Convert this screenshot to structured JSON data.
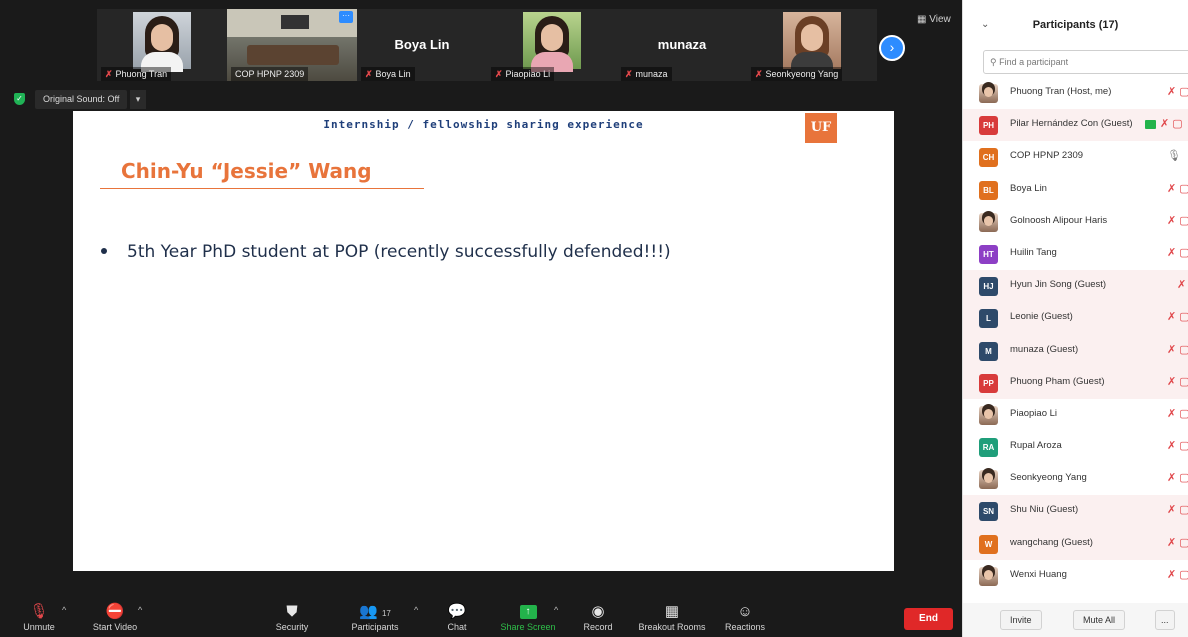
{
  "thumbnails": [
    {
      "name": "Phuong Tran",
      "type": "photo",
      "style": "light",
      "muted": true
    },
    {
      "name": "COP HPNP 2309",
      "type": "room",
      "muted": false,
      "active": true
    },
    {
      "name": "Boya Lin",
      "type": "name",
      "muted": true
    },
    {
      "name": "Piaopiao Li",
      "type": "photo",
      "style": "green",
      "muted": true
    },
    {
      "name": "munaza",
      "type": "name",
      "muted": true
    },
    {
      "name": "Seonkyeong Yang",
      "type": "photo",
      "style": "warm",
      "muted": true
    }
  ],
  "view_label": "View",
  "original_sound": "Original Sound: Off",
  "slide": {
    "header": "Internship / fellowship sharing experience",
    "logo": "UF",
    "title": "Chin-Yu “Jessie” Wang",
    "bullet": "5th Year PhD student at POP (recently successfully defended!!!)"
  },
  "toolbar": {
    "unmute": "Unmute",
    "start_video": "Start Video",
    "security": "Security",
    "participants": "Participants",
    "participants_count": "17",
    "chat": "Chat",
    "share_screen": "Share Screen",
    "record": "Record",
    "breakout_rooms": "Breakout Rooms",
    "reactions": "Reactions",
    "end": "End"
  },
  "panel": {
    "title": "Participants (17)",
    "search_placeholder": "Find a participant",
    "participants": [
      {
        "name": "Phuong Tran (Host, me)",
        "initials": "",
        "color": "",
        "photo": true,
        "shaded": false,
        "status": "muted"
      },
      {
        "name": "Pilar Hernández Con (Guest)",
        "initials": "PH",
        "color": "#d83b3b",
        "photo": false,
        "shaded": true,
        "status": "sharing"
      },
      {
        "name": "COP HPNP 2309",
        "initials": "CH",
        "color": "#e0701e",
        "photo": false,
        "shaded": false,
        "status": "unmuted"
      },
      {
        "name": "Boya Lin",
        "initials": "BL",
        "color": "#e0701e",
        "photo": false,
        "shaded": false,
        "status": "muted"
      },
      {
        "name": "Golnoosh Alipour Haris",
        "initials": "",
        "color": "",
        "photo": true,
        "shaded": false,
        "status": "muted"
      },
      {
        "name": "Huilin Tang",
        "initials": "HT",
        "color": "#8d3fc5",
        "photo": false,
        "shaded": false,
        "status": "muted"
      },
      {
        "name": "Hyun Jin Song (Guest)",
        "initials": "HJ",
        "color": "#2e4a6a",
        "photo": false,
        "shaded": true,
        "status": "muted-audio"
      },
      {
        "name": "Leonie (Guest)",
        "initials": "L",
        "color": "#2e4a6a",
        "photo": false,
        "shaded": true,
        "status": "muted"
      },
      {
        "name": "munaza (Guest)",
        "initials": "M",
        "color": "#2e4a6a",
        "photo": false,
        "shaded": true,
        "status": "muted"
      },
      {
        "name": "Phuong Pham (Guest)",
        "initials": "PP",
        "color": "#d83b3b",
        "photo": false,
        "shaded": true,
        "status": "muted"
      },
      {
        "name": "Piaopiao Li",
        "initials": "",
        "color": "",
        "photo": true,
        "shaded": false,
        "status": "muted"
      },
      {
        "name": "Rupal Aroza",
        "initials": "RA",
        "color": "#1f9e7a",
        "photo": false,
        "shaded": false,
        "status": "muted"
      },
      {
        "name": "Seonkyeong Yang",
        "initials": "",
        "color": "",
        "photo": true,
        "shaded": false,
        "status": "muted"
      },
      {
        "name": "Shu Niu (Guest)",
        "initials": "SN",
        "color": "#2e4a6a",
        "photo": false,
        "shaded": true,
        "status": "muted"
      },
      {
        "name": "wangchang (Guest)",
        "initials": "W",
        "color": "#e0701e",
        "photo": false,
        "shaded": true,
        "status": "muted"
      },
      {
        "name": "Wenxi Huang",
        "initials": "",
        "color": "",
        "photo": true,
        "shaded": false,
        "status": "muted"
      }
    ],
    "invite": "Invite",
    "mute_all": "Mute All",
    "more": "..."
  }
}
